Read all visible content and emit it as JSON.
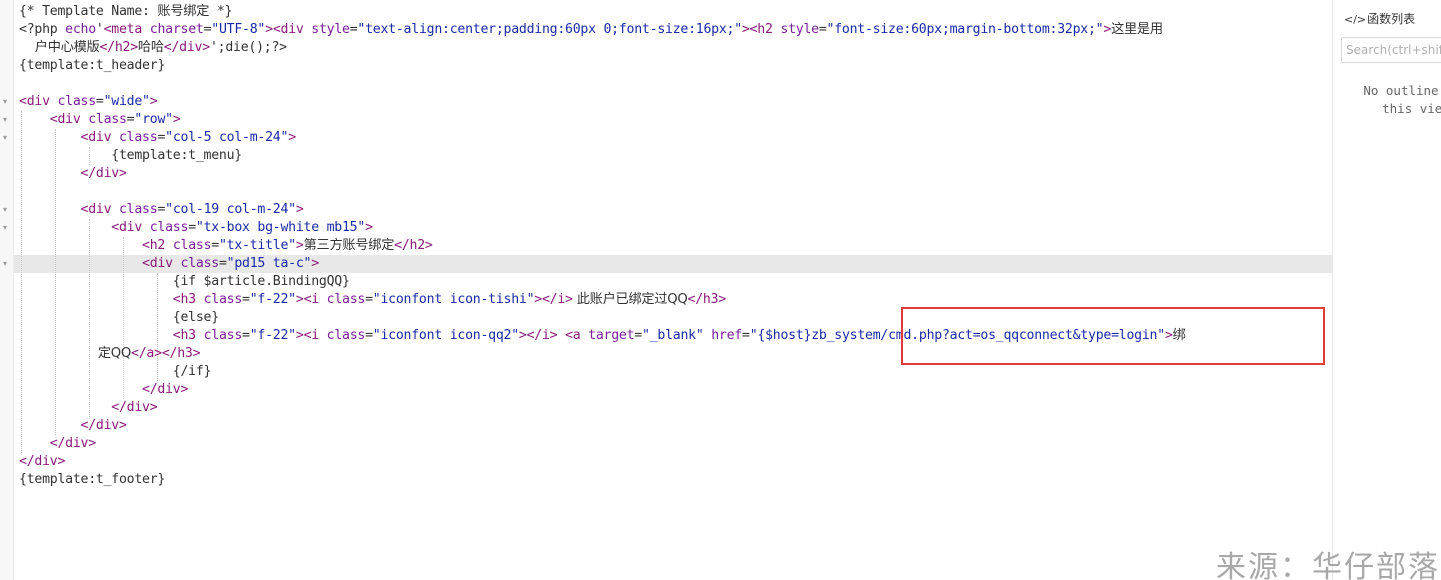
{
  "code_lines": [
    [
      {
        "t": "{* Template Name: ",
        "c": "plain"
      },
      {
        "t": "账号绑定",
        "c": "plain cjk"
      },
      {
        "t": " *}",
        "c": "plain"
      }
    ],
    [
      {
        "t": "<?php ",
        "c": "plain"
      },
      {
        "t": "echo",
        "c": "kw"
      },
      {
        "t": "'",
        "c": "plain"
      },
      {
        "t": "<meta ",
        "c": "tag"
      },
      {
        "t": "charset",
        "c": "attr"
      },
      {
        "t": "=",
        "c": "plain"
      },
      {
        "t": "\"UTF-8\"",
        "c": "str"
      },
      {
        "t": ">",
        "c": "tag"
      },
      {
        "t": "<div ",
        "c": "tag"
      },
      {
        "t": "style",
        "c": "attr"
      },
      {
        "t": "=",
        "c": "plain"
      },
      {
        "t": "\"text-align:center;padding:60px 0;font-size:16px;\"",
        "c": "str"
      },
      {
        "t": ">",
        "c": "tag"
      },
      {
        "t": "<h2 ",
        "c": "tag"
      },
      {
        "t": "style",
        "c": "attr"
      },
      {
        "t": "=",
        "c": "plain"
      },
      {
        "t": "\"font-size:60px;margin-bottom:32px;\"",
        "c": "str"
      },
      {
        "t": ">",
        "c": "tag"
      },
      {
        "t": "这里是用",
        "c": "plain cjk"
      }
    ],
    [
      {
        "t": "    户中心模版",
        "c": "plain cjk"
      },
      {
        "t": "</h2>",
        "c": "tag"
      },
      {
        "t": "哈哈",
        "c": "plain cjk"
      },
      {
        "t": "</div>",
        "c": "tag"
      },
      {
        "t": "';die();?>",
        "c": "plain"
      }
    ],
    [
      {
        "t": "{template:t_header}",
        "c": "plain"
      }
    ],
    [],
    [
      {
        "t": "<div ",
        "c": "tag"
      },
      {
        "t": "class",
        "c": "attr"
      },
      {
        "t": "=",
        "c": "plain"
      },
      {
        "t": "\"wide\"",
        "c": "str"
      },
      {
        "t": ">",
        "c": "tag"
      }
    ],
    [
      {
        "t": "    ",
        "c": "plain"
      },
      {
        "t": "<div ",
        "c": "tag"
      },
      {
        "t": "class",
        "c": "attr"
      },
      {
        "t": "=",
        "c": "plain"
      },
      {
        "t": "\"row\"",
        "c": "str"
      },
      {
        "t": ">",
        "c": "tag"
      }
    ],
    [
      {
        "t": "        ",
        "c": "plain"
      },
      {
        "t": "<div ",
        "c": "tag"
      },
      {
        "t": "class",
        "c": "attr"
      },
      {
        "t": "=",
        "c": "plain"
      },
      {
        "t": "\"col-5 col-m-24\"",
        "c": "str"
      },
      {
        "t": ">",
        "c": "tag"
      }
    ],
    [
      {
        "t": "            {template:t_menu}",
        "c": "plain"
      }
    ],
    [
      {
        "t": "        ",
        "c": "plain"
      },
      {
        "t": "</div>",
        "c": "tag"
      }
    ],
    [],
    [
      {
        "t": "        ",
        "c": "plain"
      },
      {
        "t": "<div ",
        "c": "tag"
      },
      {
        "t": "class",
        "c": "attr"
      },
      {
        "t": "=",
        "c": "plain"
      },
      {
        "t": "\"col-19 col-m-24\"",
        "c": "str"
      },
      {
        "t": ">",
        "c": "tag"
      }
    ],
    [
      {
        "t": "            ",
        "c": "plain"
      },
      {
        "t": "<div ",
        "c": "tag"
      },
      {
        "t": "class",
        "c": "attr"
      },
      {
        "t": "=",
        "c": "plain"
      },
      {
        "t": "\"tx-box bg-white mb15\"",
        "c": "str"
      },
      {
        "t": ">",
        "c": "tag"
      }
    ],
    [
      {
        "t": "                ",
        "c": "plain"
      },
      {
        "t": "<h2 ",
        "c": "tag"
      },
      {
        "t": "class",
        "c": "attr"
      },
      {
        "t": "=",
        "c": "plain"
      },
      {
        "t": "\"tx-title\"",
        "c": "str"
      },
      {
        "t": ">",
        "c": "tag"
      },
      {
        "t": "第三方账号绑定",
        "c": "plain cjk"
      },
      {
        "t": "</h2>",
        "c": "tag"
      }
    ],
    [
      {
        "t": "                ",
        "c": "plain"
      },
      {
        "t": "<div ",
        "c": "tag"
      },
      {
        "t": "class",
        "c": "attr"
      },
      {
        "t": "=",
        "c": "plain"
      },
      {
        "t": "\"pd15 ta-c\"",
        "c": "str"
      },
      {
        "t": ">",
        "c": "tag"
      }
    ],
    [
      {
        "t": "                    {if $article.BindingQQ}",
        "c": "plain"
      }
    ],
    [
      {
        "t": "                    ",
        "c": "plain"
      },
      {
        "t": "<h3 ",
        "c": "tag"
      },
      {
        "t": "class",
        "c": "attr"
      },
      {
        "t": "=",
        "c": "plain"
      },
      {
        "t": "\"f-22\"",
        "c": "str"
      },
      {
        "t": ">",
        "c": "tag"
      },
      {
        "t": "<i ",
        "c": "tag"
      },
      {
        "t": "class",
        "c": "attr"
      },
      {
        "t": "=",
        "c": "plain"
      },
      {
        "t": "\"iconfont icon-tishi\"",
        "c": "str"
      },
      {
        "t": ">",
        "c": "tag"
      },
      {
        "t": "</i>",
        "c": "tag"
      },
      {
        "t": " 此账户已绑定过QQ",
        "c": "plain cjk"
      },
      {
        "t": "</h3>",
        "c": "tag"
      }
    ],
    [
      {
        "t": "                    {else}",
        "c": "plain"
      }
    ],
    [
      {
        "t": "                    ",
        "c": "plain"
      },
      {
        "t": "<h3 ",
        "c": "tag"
      },
      {
        "t": "class",
        "c": "attr"
      },
      {
        "t": "=",
        "c": "plain"
      },
      {
        "t": "\"f-22\"",
        "c": "str"
      },
      {
        "t": ">",
        "c": "tag"
      },
      {
        "t": "<i ",
        "c": "tag"
      },
      {
        "t": "class",
        "c": "attr"
      },
      {
        "t": "=",
        "c": "plain"
      },
      {
        "t": "\"iconfont icon-qq2\"",
        "c": "str"
      },
      {
        "t": ">",
        "c": "tag"
      },
      {
        "t": "</i>",
        "c": "tag"
      },
      {
        "t": " ",
        "c": "plain"
      },
      {
        "t": "<a ",
        "c": "tag"
      },
      {
        "t": "target",
        "c": "attr"
      },
      {
        "t": "=",
        "c": "plain"
      },
      {
        "t": "\"_blank\"",
        "c": "str"
      },
      {
        "t": " ",
        "c": "plain"
      },
      {
        "t": "href",
        "c": "attr"
      },
      {
        "t": "=",
        "c": "plain"
      },
      {
        "t": "\"{$host}zb_system/cmd.php?act=os_qqconnect&type=login\"",
        "c": "str"
      },
      {
        "t": ">",
        "c": "tag"
      },
      {
        "t": "绑",
        "c": "plain cjk"
      }
    ],
    [
      {
        "t": "                    定QQ",
        "c": "plain cjk"
      },
      {
        "t": "</a>",
        "c": "tag"
      },
      {
        "t": "</h3>",
        "c": "tag"
      }
    ],
    [
      {
        "t": "                    {/if}",
        "c": "plain"
      }
    ],
    [
      {
        "t": "                ",
        "c": "plain"
      },
      {
        "t": "</div>",
        "c": "tag"
      }
    ],
    [
      {
        "t": "            ",
        "c": "plain"
      },
      {
        "t": "</div>",
        "c": "tag"
      }
    ],
    [
      {
        "t": "        ",
        "c": "plain"
      },
      {
        "t": "</div>",
        "c": "tag"
      }
    ],
    [
      {
        "t": "    ",
        "c": "plain"
      },
      {
        "t": "</div>",
        "c": "tag"
      }
    ],
    [
      {
        "t": "</div>",
        "c": "tag"
      }
    ],
    [
      {
        "t": "{template:t_footer}",
        "c": "plain"
      }
    ]
  ],
  "outline_panel": {
    "title_icon": "</>",
    "title": "函数列表",
    "search_placeholder": "Search(ctrl+shift",
    "empty_message": "No outline for this view"
  },
  "watermark": "来源：华仔部落",
  "colors": {
    "tag": "#8b1a7a",
    "attribute": "#7a1f9a",
    "string": "#1a2aa6",
    "text": "#333333",
    "highlight_box": "#e03a3a"
  }
}
